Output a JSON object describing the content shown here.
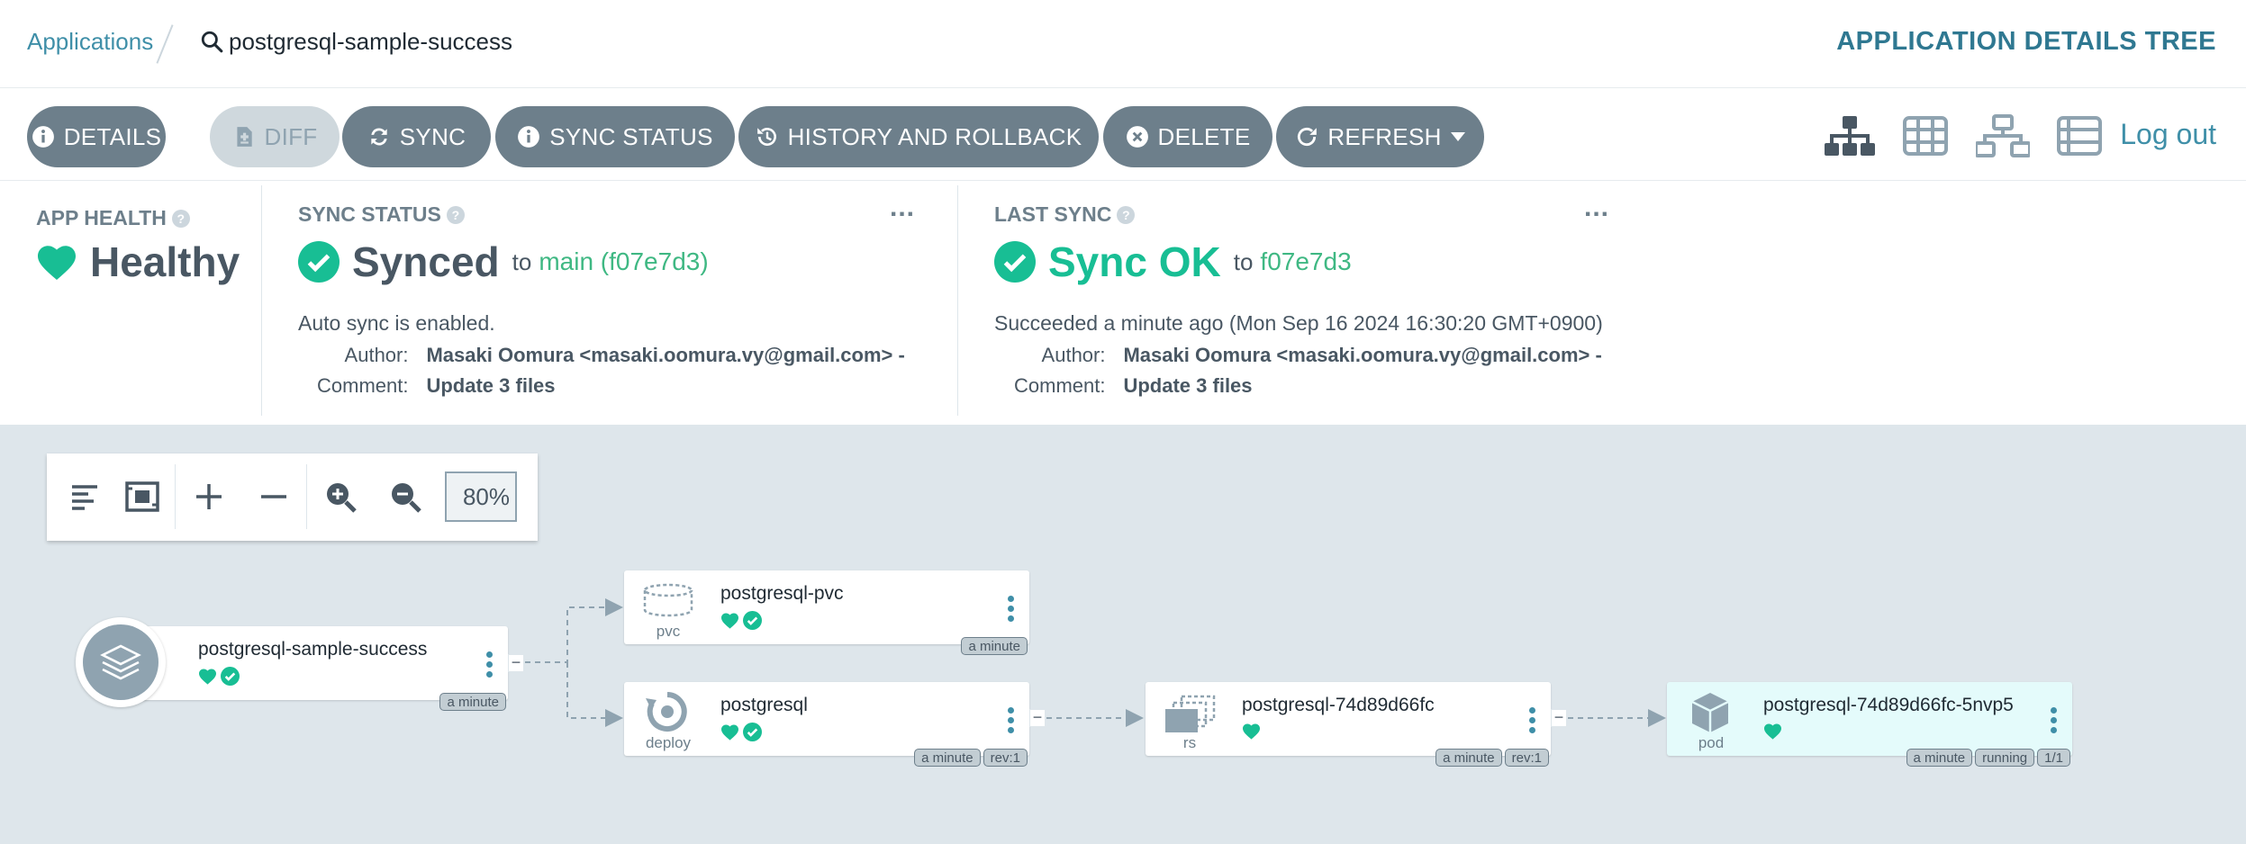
{
  "breadcrumb": {
    "applications": "Applications",
    "app_name": "postgresql-sample-success"
  },
  "view_title": "APPLICATION DETAILS TREE",
  "toolbar": {
    "details": "DETAILS",
    "diff": "DIFF",
    "sync": "SYNC",
    "sync_status": "SYNC STATUS",
    "history": "HISTORY AND ROLLBACK",
    "delete": "DELETE",
    "refresh": "REFRESH",
    "logout": "Log out"
  },
  "app_health": {
    "label": "APP HEALTH",
    "value": "Healthy",
    "color": "#18be94"
  },
  "sync_status": {
    "label": "SYNC STATUS",
    "value": "Synced",
    "to": "to",
    "revision": "main (f07e7d3)",
    "auto_sync": "Auto sync is enabled.",
    "author_label": "Author:",
    "author": "Masaki Oomura <masaki.oomura.vy@gmail.com> -",
    "comment_label": "Comment:",
    "comment": "Update 3 files"
  },
  "last_sync": {
    "label": "LAST SYNC",
    "value": "Sync OK",
    "to": "to",
    "revision": "f07e7d3",
    "succeeded": "Succeeded a minute ago (Mon Sep 16 2024 16:30:20 GMT+0900)",
    "author_label": "Author:",
    "author": "Masaki Oomura <masaki.oomura.vy@gmail.com> -",
    "comment_label": "Comment:",
    "comment": "Update 3 files"
  },
  "more_menu": "...",
  "graph_tools": {
    "zoom": "80%"
  },
  "nodes": {
    "app": {
      "name": "postgresql-sample-success",
      "tags": [
        "a minute"
      ]
    },
    "pvc": {
      "name": "postgresql-pvc",
      "kind": "pvc",
      "tags": [
        "a minute"
      ]
    },
    "deploy": {
      "name": "postgresql",
      "kind": "deploy",
      "tags": [
        "a minute",
        "rev:1"
      ]
    },
    "rs": {
      "name": "postgresql-74d89d66fc",
      "kind": "rs",
      "tags": [
        "a minute",
        "rev:1"
      ]
    },
    "pod": {
      "name": "postgresql-74d89d66fc-5nvp5",
      "kind": "pod",
      "tags": [
        "a minute",
        "running",
        "1/1"
      ]
    }
  },
  "colors": {
    "accent": "#3f8fa8",
    "healthy": "#18be94",
    "button": "#6d7f8b",
    "graph_bg": "#dee6eb"
  }
}
